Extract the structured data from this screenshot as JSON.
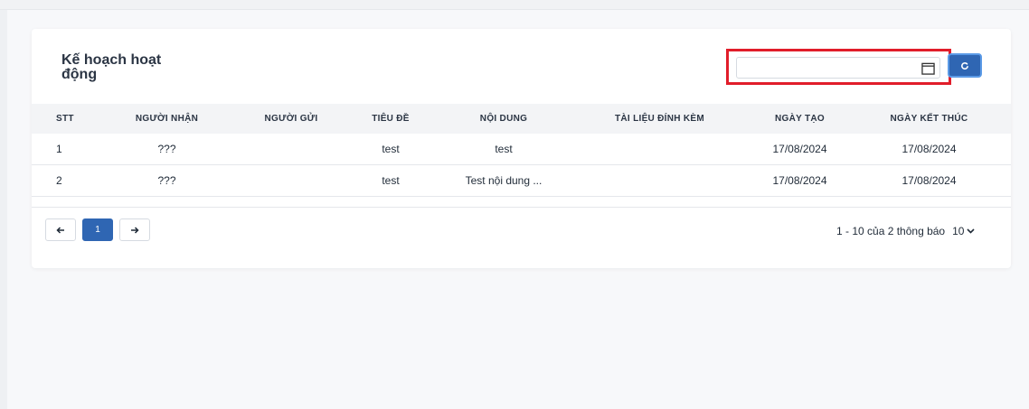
{
  "card": {
    "title": "Kế hoạch hoạt động"
  },
  "filter": {
    "date_value": "",
    "placeholder": ""
  },
  "table": {
    "columns": [
      "STT",
      "NGƯỜI NHẬN",
      "NGƯỜI GỬI",
      "TIÊU ĐỀ",
      "NỘI DUNG",
      "TÀI LIỆU ĐÍNH KÈM",
      "NGÀY TẠO",
      "NGÀY KẾT THÚC"
    ],
    "rows": [
      [
        "1",
        "???",
        "",
        "test",
        "test",
        "",
        "17/08/2024",
        "17/08/2024"
      ],
      [
        "2",
        "???",
        "",
        "test",
        "Test nội dung ...",
        "",
        "17/08/2024",
        "17/08/2024"
      ]
    ]
  },
  "pagination": {
    "prev_icon": "arrow-left-icon",
    "current_page": "1",
    "next_icon": "arrow-right-icon",
    "summary": "1 - 10 của 2 thông báo",
    "page_size": "10"
  },
  "colors": {
    "primary": "#2f66b3",
    "highlight_border": "#e11d2a"
  }
}
